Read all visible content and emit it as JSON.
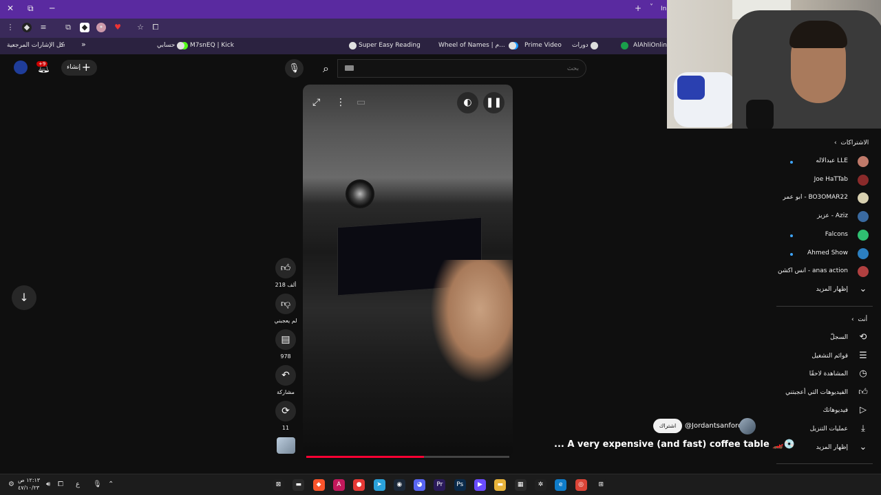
{
  "browser": {
    "tab_partial": "In",
    "bookmarks": [
      {
        "label": "AlAhliOnline",
        "color": "#1a9e4b"
      },
      {
        "label": "دورات",
        "color": "#dddddd"
      },
      {
        "label": "Prime Video",
        "color": "#1a98ff"
      },
      {
        "label": "Wheel of Names | م...",
        "color": "#e0e0e0"
      },
      {
        "label": "Super Easy Reading",
        "color": "#e0e0e0"
      },
      {
        "label": "M7snEQ | Kick",
        "color": "#53fc18"
      },
      {
        "label": "حسابي",
        "color": "#e0e0e0"
      }
    ],
    "all_bookmarks_label": "كل الإشارات المرجعية",
    "more_bookmarks": "»"
  },
  "header": {
    "create_label": "إنشاء",
    "notifications_badge": "+9",
    "search_placeholder": "بحث"
  },
  "video": {
    "progress_fraction": 0.58,
    "title": "... A very expensive (and fast) coffee table 🏎️💿",
    "channel_handle": "@Jordantsanford",
    "subscribe_label": "اشتراك"
  },
  "actions": {
    "likes": "218 ألف",
    "dislike_label": "لم يعجبني",
    "comments": "978",
    "share_label": "مشاركة",
    "remix_count": "11"
  },
  "sidebar": {
    "subscriptions_header": "الاشتراكات",
    "subscriptions": [
      {
        "name": "عبدالاله LLE",
        "color": "#c07a6a",
        "dot": true
      },
      {
        "name": "Joe HaTTab",
        "color": "#8a2a2a",
        "dot": false
      },
      {
        "name": "ابو عمر - BO3OMAR22",
        "color": "#d8d0b0",
        "dot": false
      },
      {
        "name": "عزيز - Aziz",
        "color": "#3a6aa0",
        "dot": false
      },
      {
        "name": "Falcons",
        "color": "#2fbf71",
        "dot": true
      },
      {
        "name": "Ahmed Show",
        "color": "#2c7fc0",
        "dot": true
      },
      {
        "name": "انس اكشن - anas action",
        "color": "#b04040",
        "dot": false
      }
    ],
    "subs_show_more": "إظهار المزيد",
    "you_header": "أنت",
    "you_items": [
      {
        "label": "السجلّ",
        "icon": "history-icon"
      },
      {
        "label": "قوائم التشغيل",
        "icon": "playlists-icon"
      },
      {
        "label": "المشاهدة لاحقًا",
        "icon": "watch-later-icon"
      },
      {
        "label": "الفيديوهات التي أعجبتني",
        "icon": "like-icon"
      },
      {
        "label": "فيديوهاتك",
        "icon": "your-videos-icon"
      },
      {
        "label": "عمليات التنزيل",
        "icon": "download-icon"
      }
    ],
    "you_show_more": "إظهار المزيد"
  },
  "taskbar": {
    "clock_time": "١٢:١٣ ص",
    "clock_date": "٤٧/١٠/٢٣",
    "lang": "ع",
    "apps": [
      {
        "name": "xbox-icon",
        "bg": "#1e1e1e",
        "glyph": "⊠"
      },
      {
        "name": "terminal-icon",
        "bg": "#2a2a2a",
        "glyph": "▬"
      },
      {
        "name": "brave-icon",
        "bg": "#fb542b",
        "glyph": "◆"
      },
      {
        "name": "affinity-icon",
        "bg": "#c2185b",
        "glyph": "A"
      },
      {
        "name": "app-red-icon",
        "bg": "#e53935",
        "glyph": "●"
      },
      {
        "name": "telegram-icon",
        "bg": "#2aa1da",
        "glyph": "➤"
      },
      {
        "name": "steam-icon",
        "bg": "#1b2838",
        "glyph": "◉"
      },
      {
        "name": "discord-icon",
        "bg": "#5865f2",
        "glyph": "◕"
      },
      {
        "name": "premiere-icon",
        "bg": "#2a1a5a",
        "glyph": "Pr"
      },
      {
        "name": "photoshop-icon",
        "bg": "#0a2a4a",
        "glyph": "Ps"
      },
      {
        "name": "media-icon",
        "bg": "#6a4cff",
        "glyph": "▶"
      },
      {
        "name": "folder-icon",
        "bg": "#e8b33a",
        "glyph": "▬"
      },
      {
        "name": "store-icon",
        "bg": "#2a2a2a",
        "glyph": "▦"
      },
      {
        "name": "chatgpt-icon",
        "bg": "#202020",
        "glyph": "✲"
      },
      {
        "name": "edge-icon",
        "bg": "#0f7cc9",
        "glyph": "e"
      },
      {
        "name": "chrome-icon",
        "bg": "#db4437",
        "glyph": "◎"
      },
      {
        "name": "windows-icon",
        "bg": "#1c1c1c",
        "glyph": "⊞"
      }
    ]
  }
}
